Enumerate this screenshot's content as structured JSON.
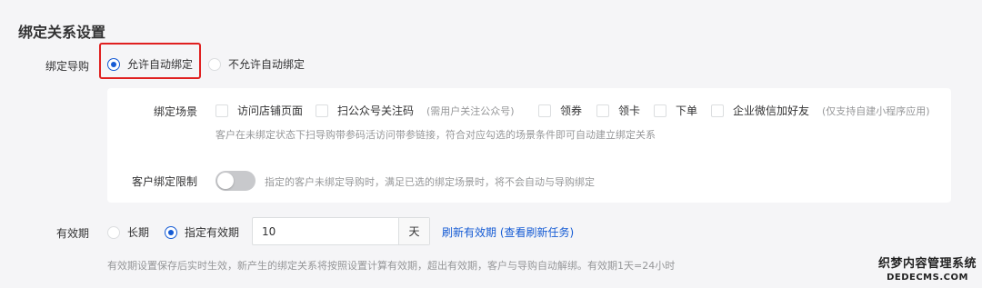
{
  "section": {
    "title": "绑定关系设置"
  },
  "bind_guide": {
    "label": "绑定导购",
    "options": [
      {
        "label": "允许自动绑定",
        "checked": true
      },
      {
        "label": "不允许自动绑定",
        "checked": false
      }
    ]
  },
  "scene": {
    "label": "绑定场景",
    "options": [
      {
        "label": "访问店铺页面",
        "hint": ""
      },
      {
        "label": "扫公众号关注码",
        "hint": "(需用户关注公众号)"
      },
      {
        "label": "领券",
        "hint": ""
      },
      {
        "label": "领卡",
        "hint": ""
      },
      {
        "label": "下单",
        "hint": ""
      },
      {
        "label": "企业微信加好友",
        "hint": "(仅支持自建小程序应用)"
      }
    ],
    "help": "客户在未绑定状态下扫导购带参码活访问带参链接，符合对应勾选的场景条件即可自动建立绑定关系"
  },
  "restriction": {
    "label": "客户绑定限制",
    "enabled": false,
    "help": "指定的客户未绑定导购时，满足已选的绑定场景时，将不会自动与导购绑定"
  },
  "validity": {
    "label": "有效期",
    "options": [
      {
        "label": "长期",
        "checked": false
      },
      {
        "label": "指定有效期",
        "checked": true
      }
    ],
    "value": "10",
    "unit": "天",
    "link": "刷新有效期 (查看刷新任务)",
    "help": "有效期设置保存后实时生效，新产生的绑定关系将按照设置计算有效期，超出有效期，客户与导购自动解绑。有效期1天=24小时"
  },
  "watermark": {
    "line1": "织梦内容管理系统",
    "line2": "DEDECMS.COM"
  },
  "colors": {
    "accent": "#155bd4",
    "highlight": "#e02020",
    "background": "#f5f5f7",
    "muted_text": "#969799"
  }
}
